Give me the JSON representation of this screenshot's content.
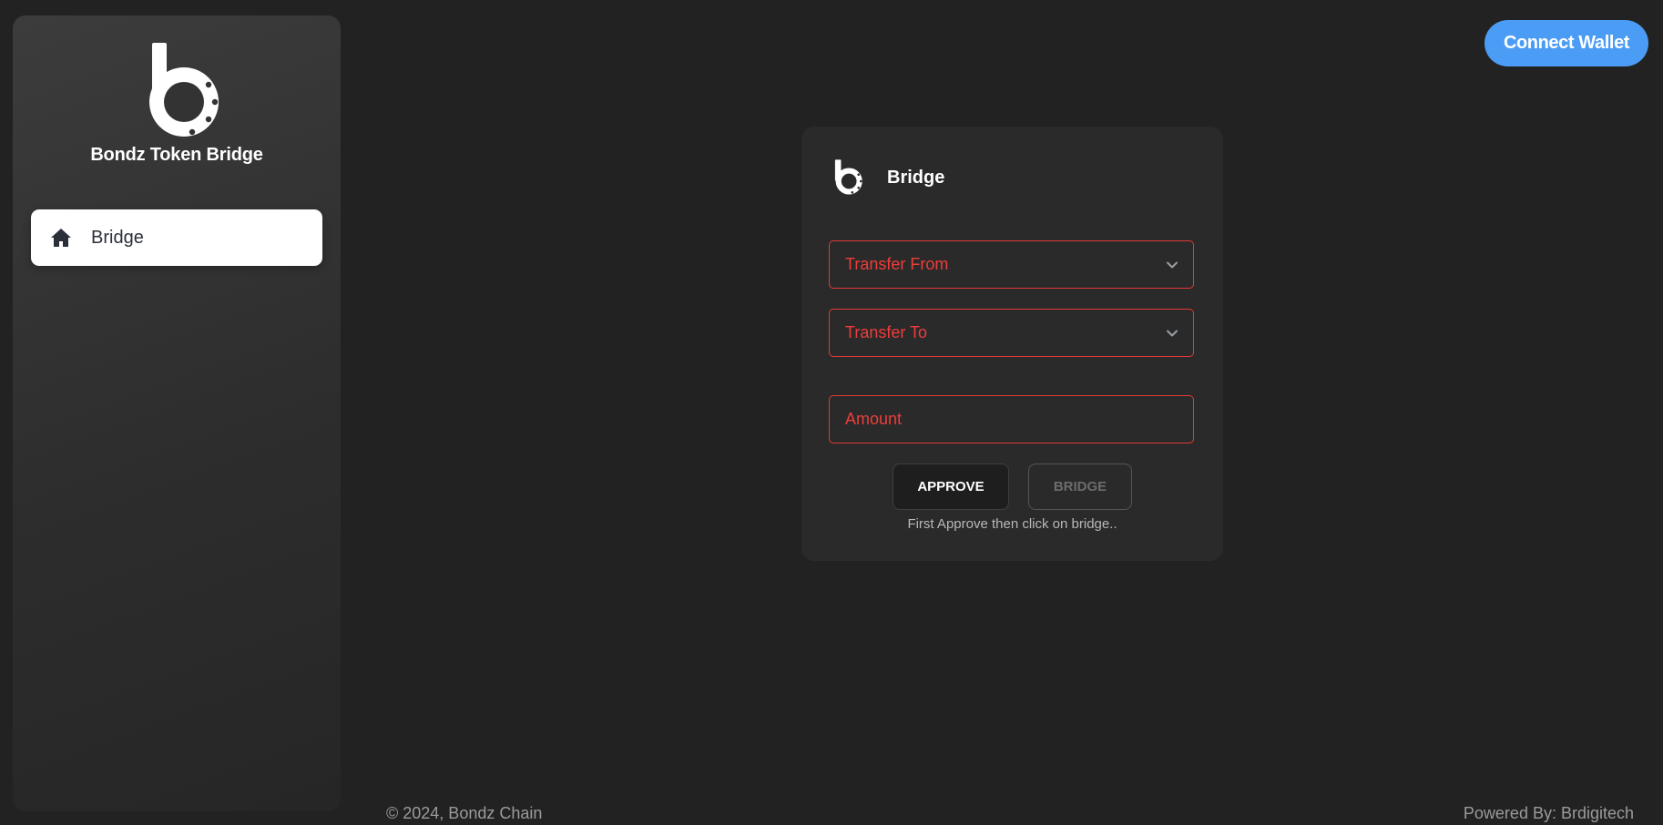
{
  "sidebar": {
    "brand_title": "Bondz Token Bridge",
    "logo": "bondz-logo",
    "items": [
      {
        "label": "Bridge",
        "icon": "home-icon",
        "active": true
      }
    ]
  },
  "header": {
    "connect_wallet_label": "Connect Wallet"
  },
  "bridge_card": {
    "title": "Bridge",
    "transfer_from_placeholder": "Transfer From",
    "transfer_to_placeholder": "Transfer To",
    "amount_placeholder": "Amount",
    "approve_label": "APPROVE",
    "bridge_label": "BRIDGE",
    "hint": "First Approve then click on bridge.."
  },
  "footer": {
    "copyright": "© 2024, Bondz Chain",
    "powered_by": "Powered By: Brdigitech"
  },
  "colors": {
    "background": "#222222",
    "accent_blue": "#4a9cf5",
    "field_error_red": "#e23b35",
    "card": "#2a2a2a"
  }
}
